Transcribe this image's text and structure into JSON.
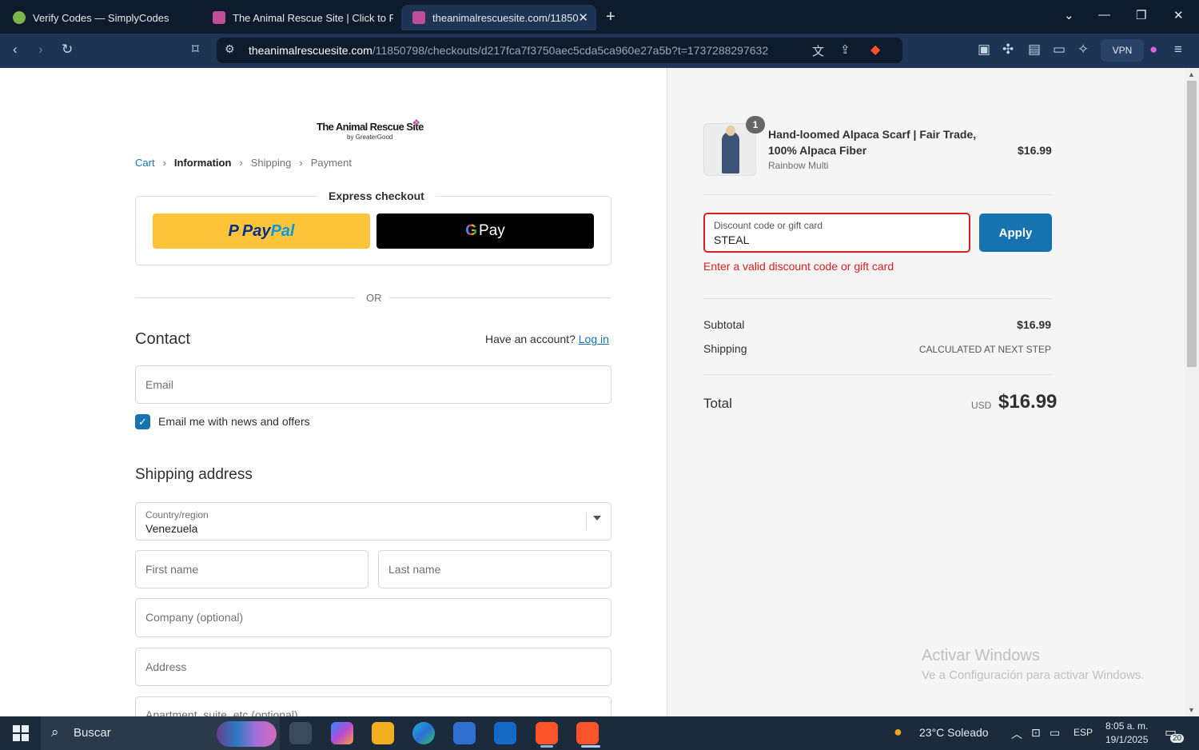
{
  "browser": {
    "tabs": [
      {
        "title": "Verify Codes — SimplyCodes"
      },
      {
        "title": "The Animal Rescue Site | Click to Fe"
      },
      {
        "title": "theanimalrescuesite.com/11850"
      }
    ],
    "url_host": "theanimalrescuesite.com",
    "url_path": "/11850798/checkouts/d217fca7f3750aec5cda5ca960e27a5b?t=1737288297632",
    "vpn_label": "VPN"
  },
  "checkout": {
    "logo_title": "The Animal Rescue Site",
    "logo_sub": "by GreaterGood",
    "breadcrumbs": {
      "cart": "Cart",
      "information": "Information",
      "shipping": "Shipping",
      "payment": "Payment"
    },
    "express_label": "Express checkout",
    "paypal_p1": "Pay",
    "paypal_p2": "Pal",
    "gpay_label": "Pay",
    "or_label": "OR",
    "contact_heading": "Contact",
    "have_account": "Have an account?",
    "login_link": "Log in",
    "email_placeholder": "Email",
    "newsletter_label": "Email me with news and offers",
    "newsletter_checked": true,
    "shipping_heading": "Shipping address",
    "country_label": "Country/region",
    "country_value": "Venezuela",
    "first_name_placeholder": "First name",
    "last_name_placeholder": "Last name",
    "company_placeholder": "Company (optional)",
    "address_placeholder": "Address",
    "apartment_placeholder": "Apartment, suite, etc (optional)"
  },
  "summary": {
    "item": {
      "quantity": "1",
      "title": "Hand-loomed Alpaca Scarf | Fair Trade, 100% Alpaca Fiber",
      "variant": "Rainbow Multi",
      "price": "$16.99"
    },
    "discount_label": "Discount code or gift card",
    "discount_value": "STEAL",
    "apply_label": "Apply",
    "discount_error": "Enter a valid discount code or gift card",
    "subtotal_label": "Subtotal",
    "subtotal_value": "$16.99",
    "shipping_label": "Shipping",
    "shipping_value": "CALCULATED AT NEXT STEP",
    "total_label": "Total",
    "total_currency": "USD",
    "total_value": "$16.99"
  },
  "watermark": {
    "line1": "Activar Windows",
    "line2": "Ve a Configuración para activar Windows."
  },
  "taskbar": {
    "search_label": "Buscar",
    "weather": "23°C  Soleado",
    "language": "ESP",
    "time": "8:05 a. m.",
    "date": "19/1/2025",
    "notifications": "20"
  },
  "colors": {
    "accent": "#1773b0",
    "error": "#dd1d1d",
    "paypal_yellow": "#ffc439",
    "chrome_dark": "#0e1b2c",
    "chrome_toolbar": "#1e3454"
  }
}
